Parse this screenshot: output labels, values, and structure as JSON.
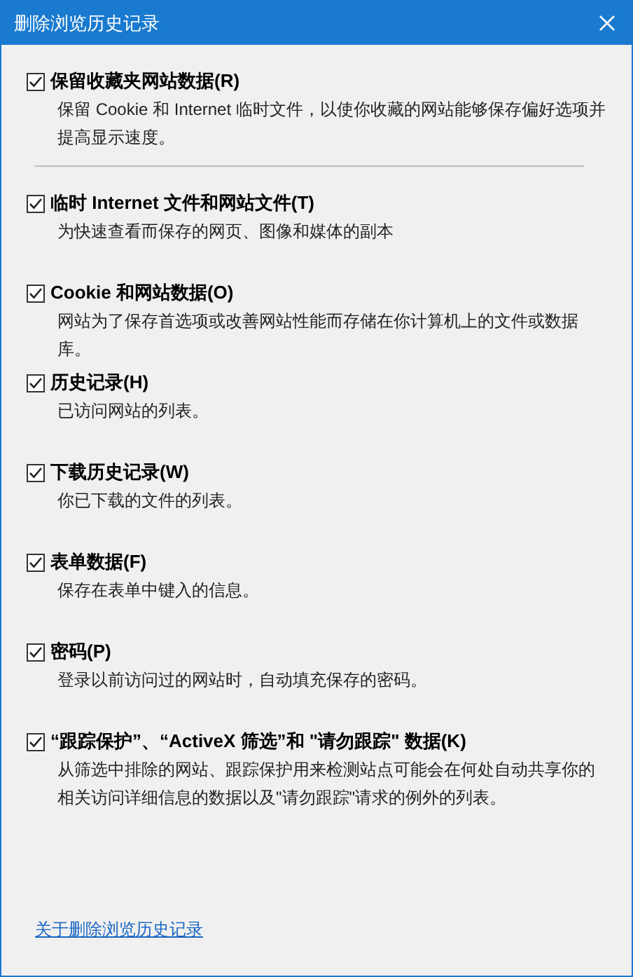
{
  "window": {
    "title": "删除浏览历史记录"
  },
  "options": [
    {
      "label": "保留收藏夹网站数据(R)",
      "description": "保留 Cookie 和 Internet 临时文件，以使你收藏的网站能够保存偏好选项并提高显示速度。",
      "checked": true
    },
    {
      "label": "临时 Internet 文件和网站文件(T)",
      "description": "为快速查看而保存的网页、图像和媒体的副本",
      "checked": true
    },
    {
      "label": "Cookie 和网站数据(O)",
      "description": "网站为了保存首选项或改善网站性能而存储在你计算机上的文件或数据库。",
      "checked": true
    },
    {
      "label": "历史记录(H)",
      "description": "已访问网站的列表。",
      "checked": true
    },
    {
      "label": "下载历史记录(W)",
      "description": "你已下载的文件的列表。",
      "checked": true
    },
    {
      "label": "表单数据(F)",
      "description": "保存在表单中键入的信息。",
      "checked": true
    },
    {
      "label": "密码(P)",
      "description": "登录以前访问过的网站时，自动填充保存的密码。",
      "checked": true
    },
    {
      "label": "“跟踪保护”、“ActiveX 筛选”和 \"请勿跟踪\" 数据(K)",
      "description": "从筛选中排除的网站、跟踪保护用来检测站点可能会在何处自动共享你的相关访问详细信息的数据以及\"请勿跟踪\"请求的例外的列表。",
      "checked": true
    }
  ],
  "link": "关于删除浏览历史记录"
}
